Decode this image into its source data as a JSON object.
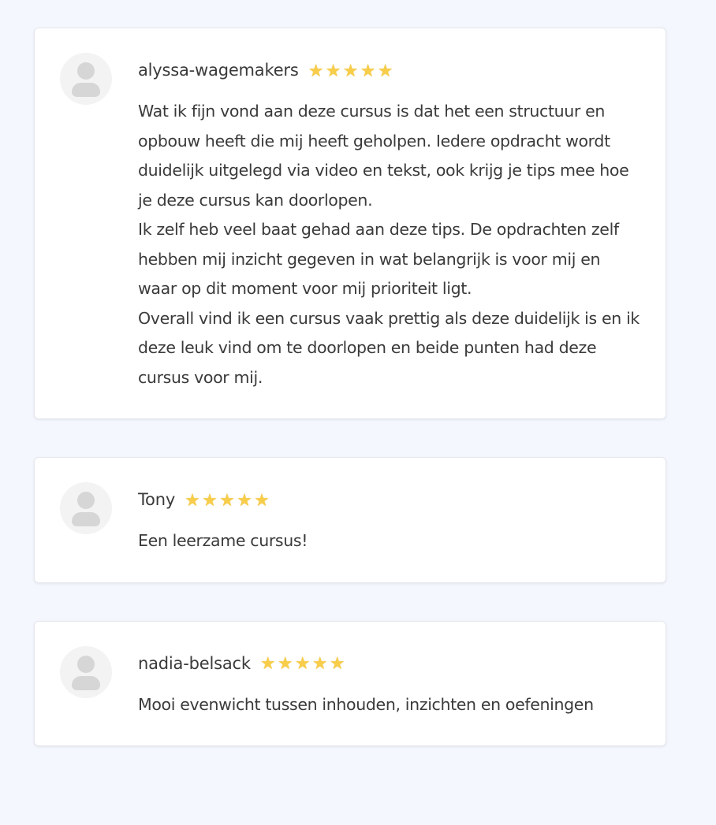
{
  "reviews": [
    {
      "name": "alyssa-wagemakers",
      "rating": 5,
      "paragraphs": [
        "Wat ik fijn vond aan deze cursus is dat het een structuur en opbouw heeft die mij heeft geholpen. Iedere opdracht wordt duidelijk uitgelegd via video en tekst, ook krijg je tips mee hoe je deze cursus kan doorlopen.",
        "Ik zelf heb veel baat gehad aan deze tips. De opdrachten zelf hebben mij inzicht gegeven in wat belangrijk is voor mij en waar op dit moment voor mij prioriteit ligt.",
        "Overall vind ik een cursus vaak prettig als deze duidelijk is en ik deze leuk vind om te doorlopen en beide punten had deze cursus voor mij."
      ]
    },
    {
      "name": "Tony",
      "rating": 5,
      "paragraphs": [
        "Een leerzame cursus!"
      ]
    },
    {
      "name": "nadia-belsack",
      "rating": 5,
      "paragraphs": [
        "Mooi evenwicht tussen inhouden, inzichten en oefeningen"
      ]
    }
  ],
  "icons": {
    "avatar": "user-avatar-icon",
    "star": "star-icon"
  },
  "colors": {
    "background": "#f4f7fd",
    "card": "#ffffff",
    "star": "#f7cd4a",
    "text": "#3a3a3a"
  }
}
